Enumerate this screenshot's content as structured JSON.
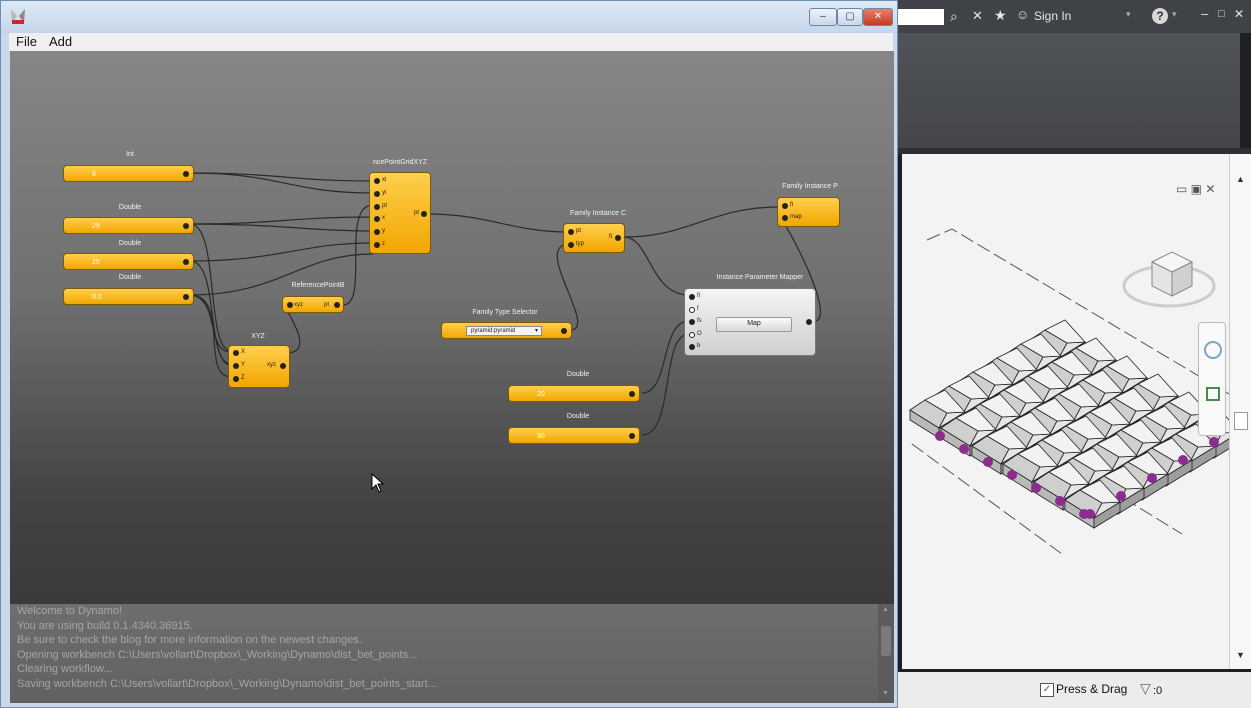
{
  "dynamo": {
    "menu": {
      "file": "File",
      "add": "Add"
    },
    "nodes": {
      "int": {
        "title": "Int",
        "value": "6"
      },
      "double_1": {
        "title": "Double",
        "value": "25"
      },
      "double_2": {
        "title": "Double",
        "value": "20"
      },
      "double_3": {
        "title": "Double",
        "value": "0.0"
      },
      "grid": {
        "title": "ncePointGridXYZ",
        "ports_in": [
          "xi",
          "yi",
          "pt",
          "x",
          "y",
          "z"
        ],
        "port_out": "pt"
      },
      "xyz": {
        "title": "XYZ",
        "ports_in": [
          "X",
          "Y",
          "Z"
        ],
        "port_out": "xyz"
      },
      "refpoint": {
        "title": "ReferencePointB",
        "port_in": "xyz",
        "port_out": "pt"
      },
      "family_instance_c": {
        "title": "Family Instance C",
        "ports_in": [
          "pt",
          "typ"
        ],
        "port_out": "fi"
      },
      "family_type_selector": {
        "title": "Family Type Selector",
        "selected": "pyramid:pyramid"
      },
      "family_instance_p": {
        "title": "Family Instance P",
        "ports_in": [
          "fi",
          "map"
        ]
      },
      "mapper": {
        "title": "Instance Parameter Mapper",
        "ports_in": [
          "fi",
          "f",
          "fs",
          "O",
          "b"
        ],
        "button": "Map"
      },
      "double_4": {
        "title": "Double",
        "value": "20"
      },
      "double_5": {
        "title": "Double",
        "value": "30"
      }
    },
    "console_lines": [
      "Welcome to Dynamo!",
      "You are using build 0.1.4340.36915.",
      "Be sure to check the blog for more information on the newest changes.",
      "Opening workbench C:\\Users\\vollart\\Dropbox\\_Working\\Dynamo\\dist_bet_points...",
      "Clearing workflow...",
      "Saving workbench C:\\Users\\vollart\\Dropbox\\_Working\\Dynamo\\dist_bet_points_start..."
    ]
  },
  "revit": {
    "sign_in": "Sign In",
    "help": "?",
    "status": {
      "press_drag": "Press & Drag",
      "filter_count": ":0",
      "press_drag_checked": true
    },
    "pyramid_color": "#cfcfcf",
    "point_color": "#8e2c8e"
  },
  "colors": {
    "node": "#f5b015",
    "canvas_top": "#868686",
    "canvas_bottom": "#3a3a3a",
    "console_text": "#a5a5a5"
  }
}
